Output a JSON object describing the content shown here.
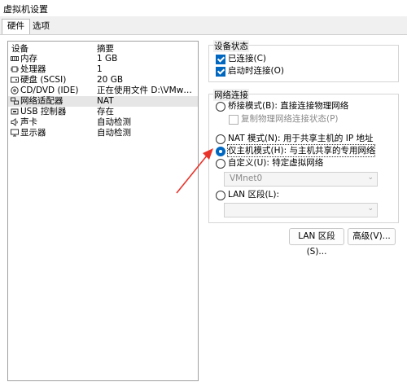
{
  "window": {
    "title": "虚拟机设置"
  },
  "tabs": [
    {
      "label": "硬件"
    },
    {
      "label": "选项"
    }
  ],
  "device_list": {
    "columns": {
      "device": "设备",
      "summary": "摘要"
    },
    "rows": [
      {
        "icon": "memory-icon",
        "name": "内存",
        "summary": "1 GB"
      },
      {
        "icon": "cpu-icon",
        "name": "处理器",
        "summary": "1"
      },
      {
        "icon": "disk-icon",
        "name": "硬盘 (SCSI)",
        "summary": "20 GB"
      },
      {
        "icon": "cd-icon",
        "name": "CD/DVD (IDE)",
        "summary": "正在使用文件 D:\\VMware\\V..."
      },
      {
        "icon": "network-icon",
        "name": "网络适配器",
        "summary": "NAT"
      },
      {
        "icon": "usb-icon",
        "name": "USB 控制器",
        "summary": "存在"
      },
      {
        "icon": "speaker-icon",
        "name": "声卡",
        "summary": "自动检测"
      },
      {
        "icon": "monitor-icon",
        "name": "显示器",
        "summary": "自动检测"
      }
    ]
  },
  "device_status": {
    "title": "设备状态",
    "connected": {
      "label": "已连接(C)",
      "checked": true
    },
    "connect_on_power": {
      "label": "启动时连接(O)",
      "checked": true
    }
  },
  "network": {
    "title": "网络连接",
    "bridged": {
      "label": "桥接模式(B): 直接连接物理网络"
    },
    "replicate": {
      "label": "复制物理网络连接状态(P)"
    },
    "nat": {
      "label": "NAT 模式(N): 用于共享主机的 IP 地址"
    },
    "host_only": {
      "label": "仅主机模式(H): 与主机共享的专用网络"
    },
    "custom": {
      "label": "自定义(U): 特定虚拟网络"
    },
    "custom_value": "VMnet0",
    "lan": {
      "label": "LAN 区段(L):"
    },
    "lan_value": ""
  },
  "buttons": {
    "lan_segments": "LAN 区段(S)...",
    "advanced": "高级(V)..."
  },
  "colors": {
    "accent": "#0067c0",
    "annotation_arrow": "#e8332a"
  }
}
